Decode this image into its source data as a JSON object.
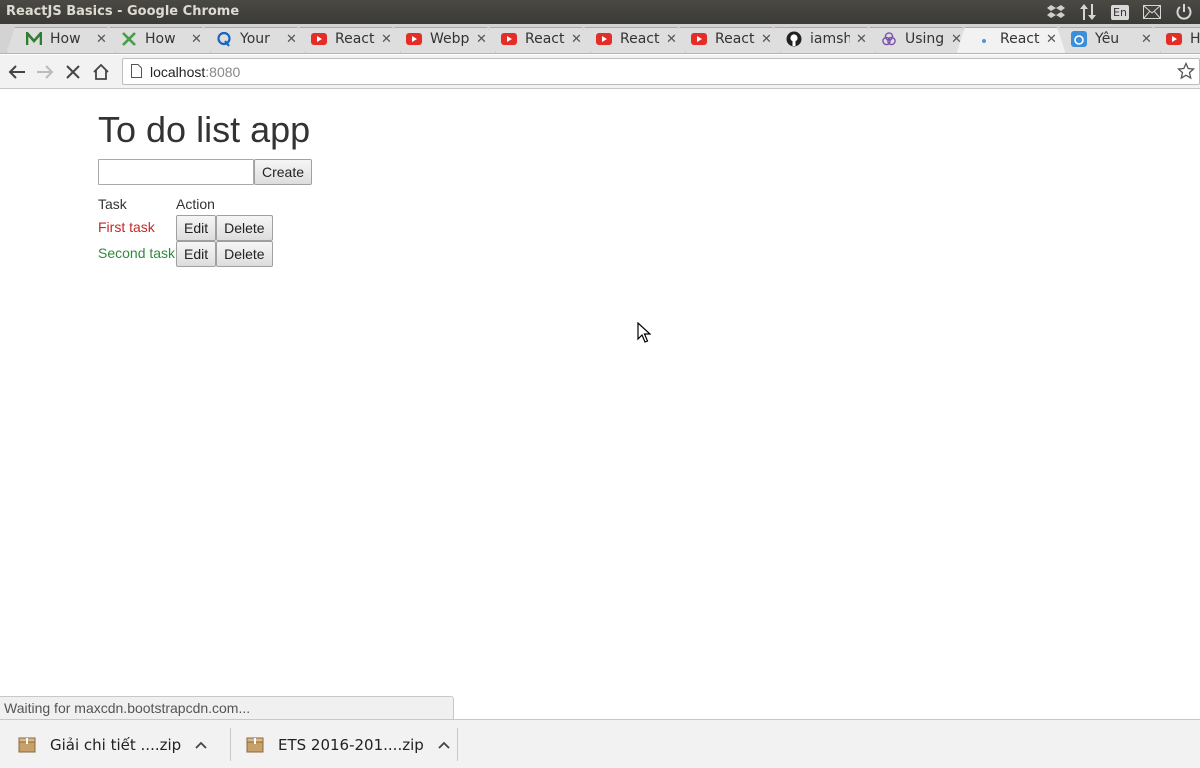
{
  "window": {
    "title": "ReactJS Basics - Google Chrome",
    "lang_indicator": "En"
  },
  "tabs": [
    {
      "label": "How",
      "icon": "medium-icon",
      "color": "#2e7d32"
    },
    {
      "label": "How",
      "icon": "logo-x-icon",
      "color": "#43a047"
    },
    {
      "label": "Your",
      "icon": "quora-icon",
      "color": "#1565c0"
    },
    {
      "label": "React",
      "icon": "youtube-icon",
      "color": "#e52d27"
    },
    {
      "label": "Webpack",
      "icon": "youtube-icon",
      "color": "#e52d27"
    },
    {
      "label": "React",
      "icon": "youtube-icon",
      "color": "#e52d27"
    },
    {
      "label": "React",
      "icon": "youtube-icon",
      "color": "#e52d27"
    },
    {
      "label": "React",
      "icon": "youtube-icon",
      "color": "#e52d27"
    },
    {
      "label": "iamsh",
      "icon": "github-icon",
      "color": "#222222"
    },
    {
      "label": "Using",
      "icon": "redux-icon",
      "color": "#7b52ab"
    },
    {
      "label": "React",
      "icon": "loading-icon",
      "color": "#5a8fd0",
      "active": true
    },
    {
      "label": "Yêu",
      "icon": "site-icon",
      "color": "#3b8fd8"
    },
    {
      "label": "Ha",
      "icon": "youtube-icon",
      "color": "#e52d27"
    }
  ],
  "address_bar": {
    "host": "localhost",
    "port": ":8080"
  },
  "app": {
    "title": "To do list app",
    "input_value": "",
    "create_label": "Create",
    "columns": [
      "Task",
      "Action"
    ],
    "tasks": [
      {
        "name": "First task",
        "color": "#c62828",
        "edit_label": "Edit",
        "delete_label": "Delete"
      },
      {
        "name": "Second task",
        "color": "#2e8b3a",
        "edit_label": "Edit",
        "delete_label": "Delete"
      }
    ]
  },
  "status": {
    "text": "Waiting for maxcdn.bootstrapcdn.com..."
  },
  "downloads": [
    {
      "name": "Giải chi tiết ....zip"
    },
    {
      "name": "ETS 2016-201....zip"
    }
  ]
}
